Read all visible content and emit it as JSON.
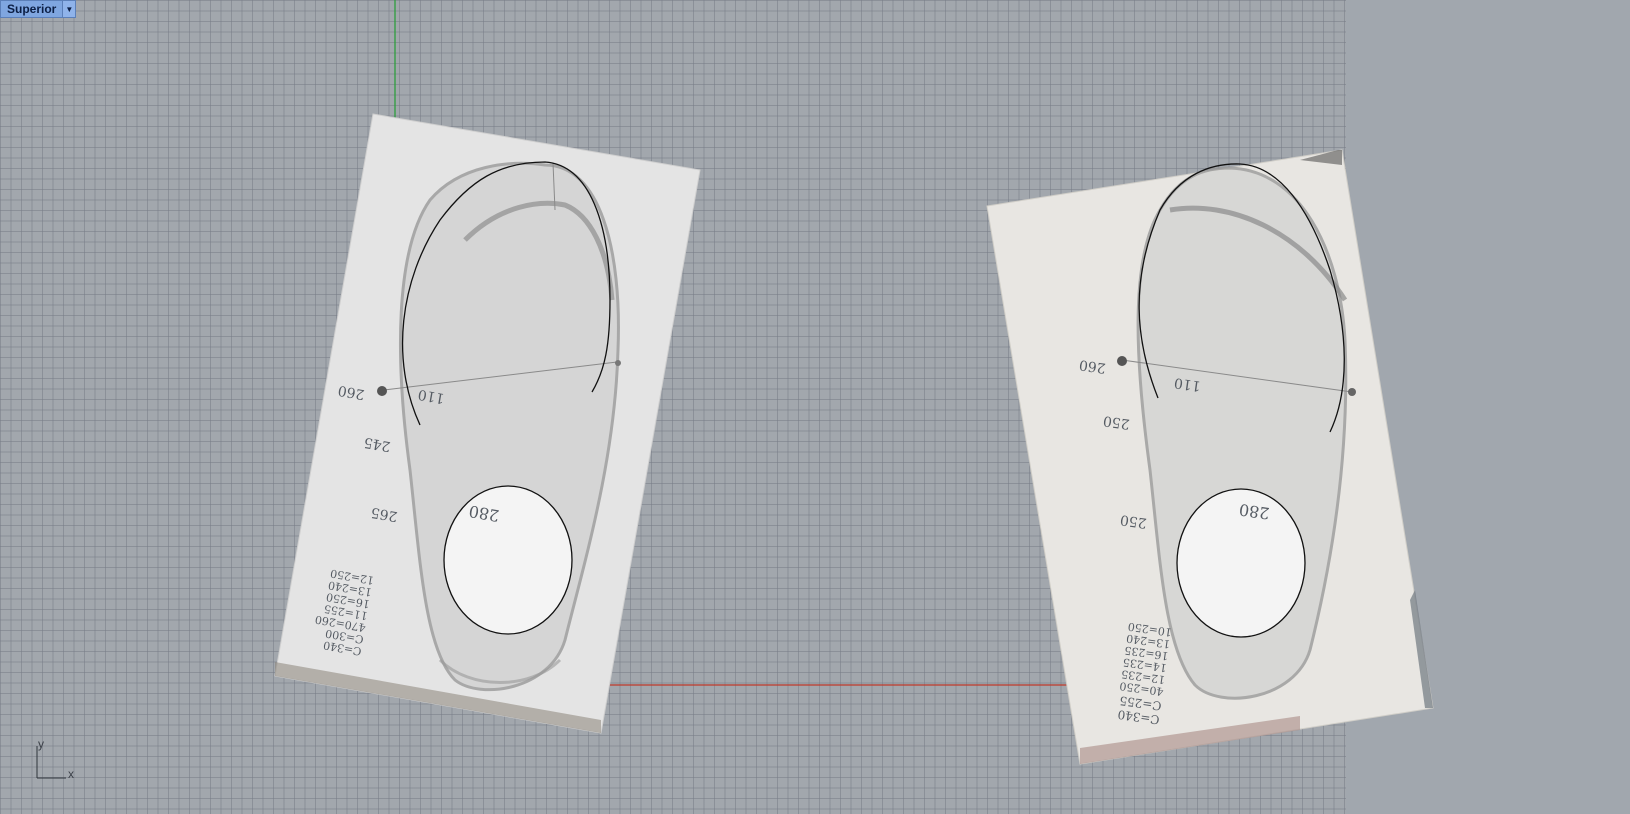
{
  "viewport": {
    "name": "Superior",
    "dropdown_icon": "chevron-down-icon"
  },
  "axis_widget": {
    "y_label": "y",
    "x_label": "x"
  },
  "left_sheet": {
    "measure_top": "110",
    "measure_left": "260",
    "side_a": "245",
    "side_b": "265",
    "heel": "280",
    "notes": [
      "C=340",
      "C=300",
      "470=260",
      "11=255",
      "16=250",
      "13=240",
      "12=250"
    ]
  },
  "right_sheet": {
    "measure_top": "110",
    "measure_left": "260",
    "side_a": "250",
    "side_b": "250",
    "heel": "280",
    "notes": [
      "C=340",
      "C=255",
      "40=250",
      "12=235",
      "14=235",
      "16=235",
      "13=240",
      "10=250"
    ]
  },
  "colors": {
    "grid_bg": "#a2a7ad",
    "x_axis": "#c0392b",
    "y_axis": "#2e9e3e",
    "curve": "#111111"
  }
}
